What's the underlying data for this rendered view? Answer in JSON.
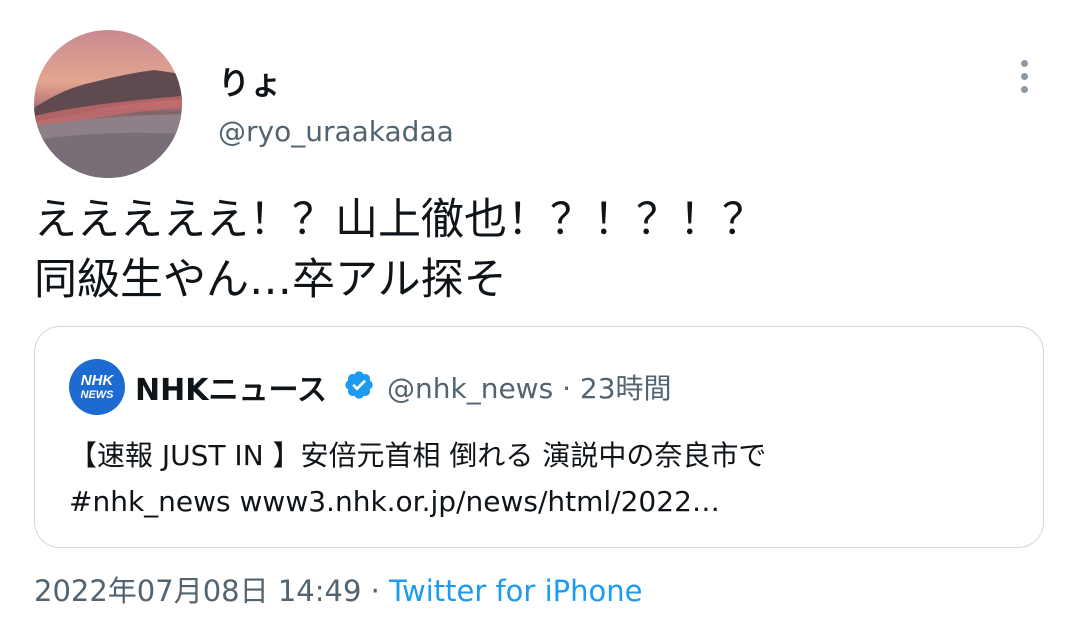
{
  "author": {
    "name": "りょ",
    "handle": "@ryo_uraakadaa",
    "avatar_icon": "sunset-beach-avatar"
  },
  "tweet": {
    "text_line1": "えええええ！？山上徹也！？！？！？",
    "text_line2": "同級生やん…卒アル探そ"
  },
  "quoted_tweet": {
    "name": "NHKニュース",
    "verified": true,
    "handle": "@nhk_news",
    "time_sep": " · ",
    "time": "23時間",
    "logo_line1": "NHK",
    "logo_line2": "NEWS",
    "text_line1": "【速報 JUST IN 】安倍元首相 倒れる 演説中の奈良市で",
    "text_line2": "#nhk_news www3.nhk.or.jp/news/html/2022…"
  },
  "meta": {
    "timestamp": "2022年07月08日 14:49",
    "sep": " · ",
    "source": "Twitter for iPhone"
  },
  "colors": {
    "verified": "#1d9bf0",
    "link": "#1d9bf0",
    "secondary_text": "#536471",
    "nhk_blue": "#1d6ad0"
  }
}
